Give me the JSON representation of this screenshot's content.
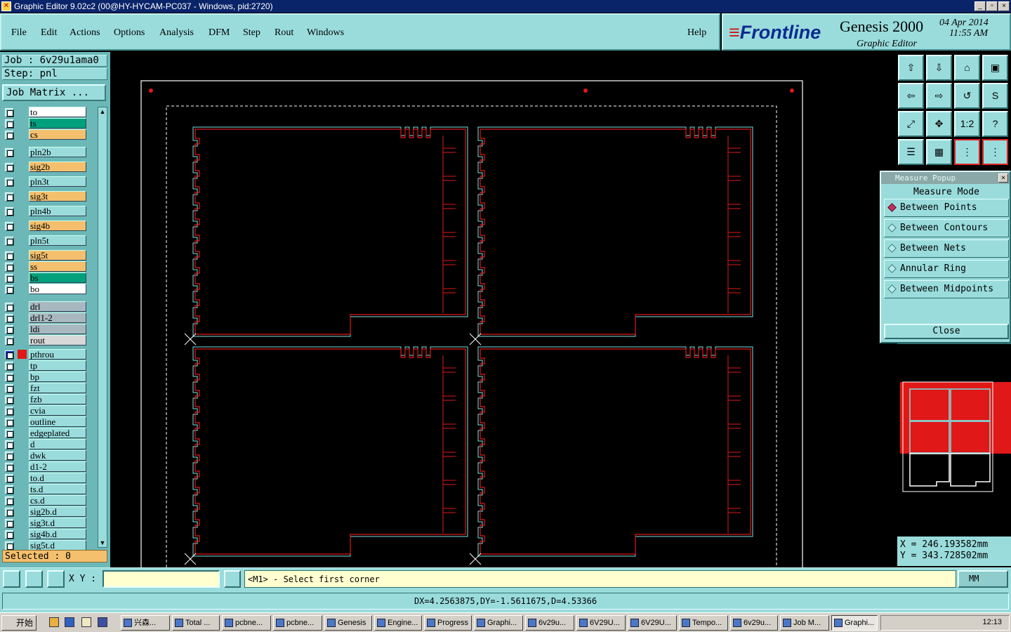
{
  "window": {
    "title": "Graphic Editor 9.02c2 (00@HY-HYCAM-PC037 - Windows, pid:2720)",
    "minimize": "_",
    "maximize": "▫",
    "close": "×"
  },
  "menu": {
    "items": [
      "File",
      "Edit",
      "Actions",
      "Options",
      "Analysis",
      "DFM",
      "Step",
      "Rout",
      "Windows"
    ],
    "help": "Help"
  },
  "brand": {
    "logo": "Frontline",
    "product": "Genesis 2000",
    "subtitle": "Graphic Editor",
    "date": "04 Apr 2014",
    "time": "11:55 AM"
  },
  "job": {
    "job_label": "Job  :  6v29u1ama0",
    "step_label": "Step: pnl",
    "job_matrix": "Job Matrix ..."
  },
  "layers": [
    {
      "name": "to",
      "color": "#ffffff"
    },
    {
      "name": "ts",
      "color": "#00a07c"
    },
    {
      "name": "cs",
      "color": "#f4c06e"
    },
    {
      "name": "pln2b",
      "color": "#9adcdc"
    },
    {
      "name": "sig2b",
      "color": "#f4c06e"
    },
    {
      "name": "pln3t",
      "color": "#9adcdc"
    },
    {
      "name": "sig3t",
      "color": "#f4c06e"
    },
    {
      "name": "pln4b",
      "color": "#9adcdc"
    },
    {
      "name": "sig4b",
      "color": "#f4c06e"
    },
    {
      "name": "pln5t",
      "color": "#9adcdc"
    },
    {
      "name": "sig5t",
      "color": "#f4c06e"
    },
    {
      "name": "ss",
      "color": "#f4c06e"
    },
    {
      "name": "bs",
      "color": "#00a07c"
    },
    {
      "name": "bo",
      "color": "#ffffff"
    },
    {
      "name": "drl",
      "color": "#a8b8c0"
    },
    {
      "name": "drl1-2",
      "color": "#a8b8c0"
    },
    {
      "name": "ldi",
      "color": "#a8b8c0"
    },
    {
      "name": "rout",
      "color": "#d8d8d8"
    },
    {
      "name": "pthrou",
      "color": "#9adcdc",
      "active": true
    },
    {
      "name": "tp",
      "color": "#9adcdc"
    },
    {
      "name": "bp",
      "color": "#9adcdc"
    },
    {
      "name": "fzt",
      "color": "#9adcdc"
    },
    {
      "name": "fzb",
      "color": "#9adcdc"
    },
    {
      "name": "cvia",
      "color": "#9adcdc"
    },
    {
      "name": "outline",
      "color": "#9adcdc"
    },
    {
      "name": "edgeplated",
      "color": "#9adcdc"
    },
    {
      "name": "d",
      "color": "#9adcdc"
    },
    {
      "name": "dwk",
      "color": "#9adcdc"
    },
    {
      "name": "d1-2",
      "color": "#9adcdc"
    },
    {
      "name": "to.d",
      "color": "#9adcdc"
    },
    {
      "name": "ts.d",
      "color": "#9adcdc"
    },
    {
      "name": "cs.d",
      "color": "#9adcdc"
    },
    {
      "name": "sig2b.d",
      "color": "#9adcdc"
    },
    {
      "name": "sig3t.d",
      "color": "#9adcdc"
    },
    {
      "name": "sig4b.d",
      "color": "#9adcdc"
    },
    {
      "name": "sig5t.d",
      "color": "#9adcdc"
    }
  ],
  "selected": "Selected : 0",
  "measure": {
    "title": "Measure Popup",
    "heading": "Measure Mode",
    "options": [
      "Between Points",
      "Between Contours",
      "Between Nets",
      "Annular Ring",
      "Between Midpoints"
    ],
    "selected_option": "Between Points",
    "close": "Close"
  },
  "coords": {
    "x": "X  =  246.193582mm",
    "y": "Y  =  343.728502mm"
  },
  "command": {
    "xy_label": "X Y :",
    "xy_value": "",
    "prompt": "<M1> - Select first corner",
    "units": "MM"
  },
  "status": "DX=4.2563875,DY=-1.5611675,D=4.53366",
  "taskbar": {
    "start": "开始",
    "tasks": [
      "兴森...",
      "Total ...",
      "pcbne...",
      "pcbne...",
      "Genesis",
      "Engine...",
      "Progress",
      "Graphi...",
      "6v29u...",
      "6V29U...",
      "6V29U...",
      "Tempo...",
      "6v29u...",
      "Job M...",
      "Graphi..."
    ],
    "active_task": "Graphi...",
    "clock": "12:13"
  },
  "colors": {
    "panel": "#9adcdc",
    "outline_red": "#e01818",
    "outline_cyan": "#7ee0e0"
  }
}
